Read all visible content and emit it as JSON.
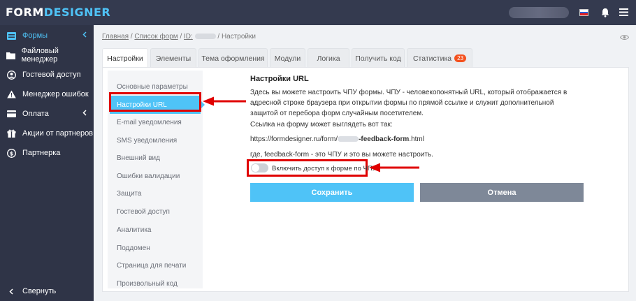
{
  "app": {
    "logo_main": "FORM",
    "logo_accent": "DESIGNER"
  },
  "sidebar": {
    "items": [
      {
        "label": "Формы",
        "icon": "forms-icon",
        "active": true
      },
      {
        "label": "Файловый менеджер",
        "icon": "folder-icon"
      },
      {
        "label": "Гостевой доступ",
        "icon": "user-circle-icon"
      },
      {
        "label": "Менеджер ошибок",
        "icon": "warning-icon"
      },
      {
        "label": "Оплата",
        "icon": "credit-card-icon"
      },
      {
        "label": "Акции от партнеров",
        "icon": "gift-icon"
      },
      {
        "label": "Партнерка",
        "icon": "dollar-icon"
      }
    ],
    "collapse_label": "Свернуть"
  },
  "breadcrumb": {
    "home": "Главная",
    "forms_list": "Список форм",
    "id_label": "ID:",
    "current": "Настройки"
  },
  "tabs": [
    {
      "label": "Настройки",
      "active": true
    },
    {
      "label": "Элементы"
    },
    {
      "label": "Тема оформления"
    },
    {
      "label": "Модули"
    },
    {
      "label": "Логика"
    },
    {
      "label": "Получить код"
    },
    {
      "label": "Статистика",
      "badge": "23"
    }
  ],
  "subnav": {
    "items": [
      "Основные параметры",
      "Настройки URL",
      "E-mail уведомления",
      "SMS уведомления",
      "Внешний вид",
      "Ошибки валидации",
      "Защита",
      "Гостевой доступ",
      "Аналитика",
      "Поддомен",
      "Страница для печати",
      "Произвольный код"
    ],
    "active_index": 1
  },
  "content": {
    "title": "Настройки URL",
    "description": "Здесь вы можете настроить ЧПУ формы. ЧПУ - человекопонятный URL, который отображается в адресной строке браузера при открытии формы по прямой ссылке и служит дополнительной защитой от перебора форм случайным посетителем.",
    "link_lead": "Ссылка на форму может выглядеть вот так:",
    "url_prefix": "https://formdesigner.ru/form/",
    "url_slug": "-feedback-form",
    "url_suffix": ".html",
    "where_text": "где, feedback-form - это ЧПУ и это вы можете настроить.",
    "toggle_label": "Включить доступ к форме по ЧПУ",
    "toggle_on": false
  },
  "buttons": {
    "save": "Сохранить",
    "cancel": "Отмена"
  },
  "colors": {
    "accent": "#4fc3f7",
    "topbar": "#343a4f",
    "sidebar": "#2f3447",
    "highlight_red": "#e00000",
    "cancel_gray": "#7e8898",
    "badge": "#f4511e"
  }
}
